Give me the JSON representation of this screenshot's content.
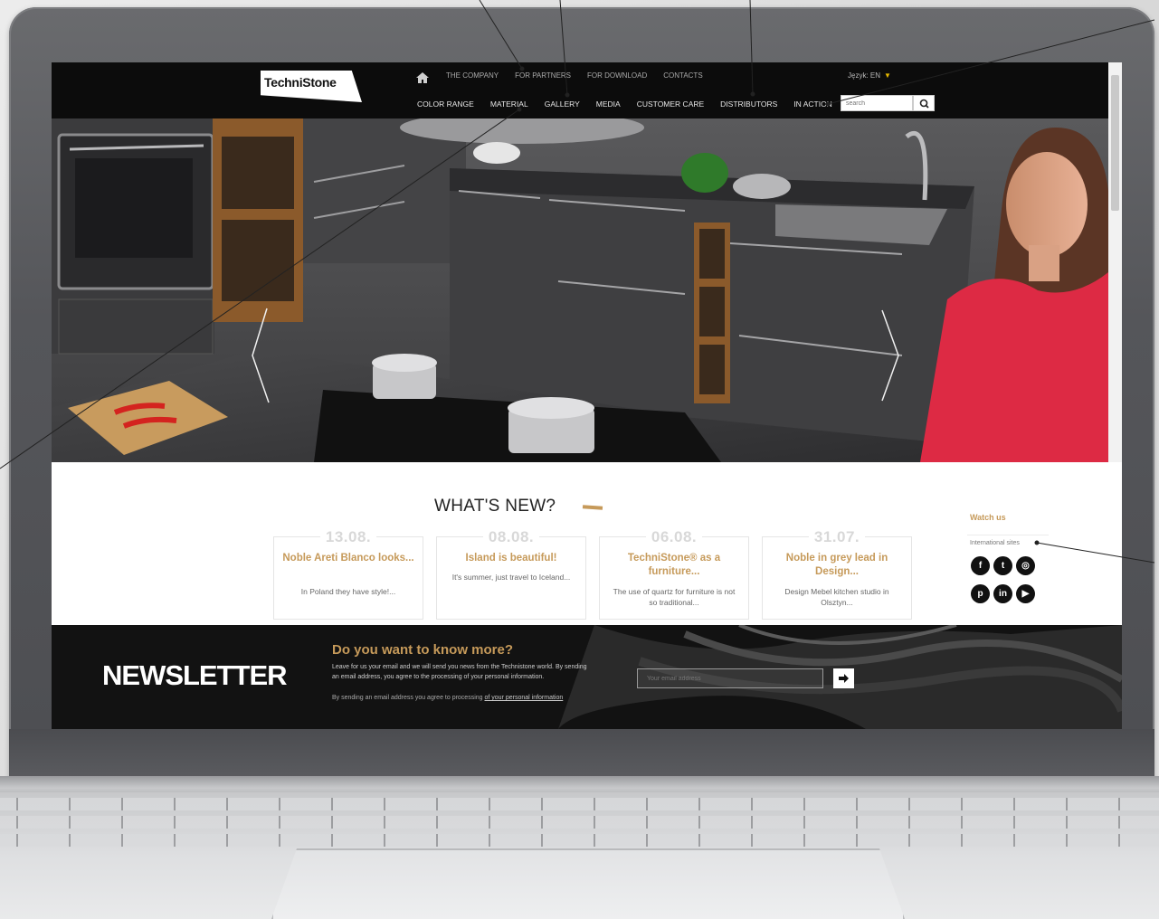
{
  "header": {
    "logo_text": "TechniStone",
    "top_nav": [
      "THE COMPANY",
      "FOR PARTNERS",
      "FOR DOWNLOAD",
      "CONTACTS"
    ],
    "language_label": "Język: EN",
    "language_arrow": "▼",
    "main_nav": [
      "COLOR RANGE",
      "MATERIAL",
      "GALLERY",
      "MEDIA",
      "CUSTOMER CARE",
      "DISTRIBUTORS",
      "IN ACTION"
    ],
    "search_placeholder": "search"
  },
  "whats_new": {
    "title": "WHAT'S NEW?",
    "cards": [
      {
        "date": "13.08.",
        "title": "Noble Areti Blanco looks...",
        "text": "In Poland they have style!..."
      },
      {
        "date": "08.08.",
        "title": "Island is beautiful!",
        "text": "It's summer, just travel to Iceland..."
      },
      {
        "date": "06.08.",
        "title": "TechniStone® as a furniture...",
        "text": "The use of quartz for furniture is not so traditional..."
      },
      {
        "date": "31.07.",
        "title": "Noble in grey lead in Design...",
        "text": "Design Mebel kitchen studio in Olsztyn..."
      }
    ],
    "watch_us": "Watch us",
    "international_sites": "International sites",
    "social": [
      {
        "icon": "facebook-icon",
        "glyph": "f"
      },
      {
        "icon": "twitter-icon",
        "glyph": "t"
      },
      {
        "icon": "instagram-icon",
        "glyph": "◎"
      },
      {
        "icon": "pinterest-icon",
        "glyph": "p"
      },
      {
        "icon": "linkedin-icon",
        "glyph": "in"
      },
      {
        "icon": "youtube-icon",
        "glyph": "▶"
      }
    ]
  },
  "newsletter": {
    "heading": "NEWSLETTER",
    "question": "Do you want to know more?",
    "text": "Leave for us your email and we will send you news from the Technistone world. By sending an email address, you agree to the processing of your personal information.",
    "consent_prefix": "By sending an email address you agree to processing ",
    "consent_link": "of your personal information",
    "email_placeholder": "Your email address",
    "submit_glyph": "➜"
  },
  "colors": {
    "accent_gold": "#c69a5a",
    "header_bg": "#0c0c0c",
    "lang_accent": "#e6b800"
  }
}
